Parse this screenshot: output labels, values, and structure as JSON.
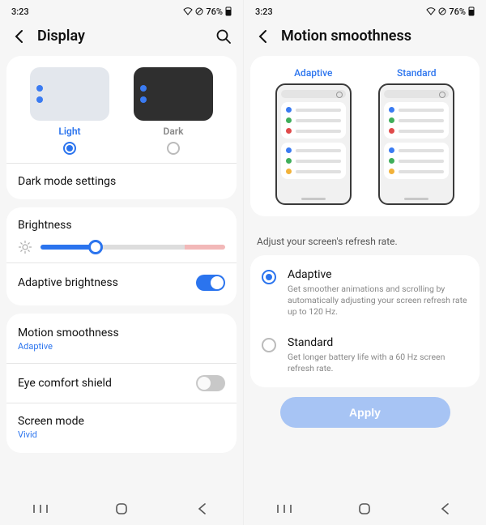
{
  "status": {
    "time": "3:23",
    "battery": "76%"
  },
  "left": {
    "title": "Display",
    "theme": {
      "light_label": "Light",
      "dark_label": "Dark",
      "selected": "light"
    },
    "dark_mode_settings": "Dark mode settings",
    "brightness": {
      "label": "Brightness",
      "value_pct": 30
    },
    "adaptive_brightness": {
      "label": "Adaptive brightness",
      "on": true
    },
    "motion_smoothness": {
      "label": "Motion smoothness",
      "value": "Adaptive"
    },
    "eye_comfort": {
      "label": "Eye comfort shield",
      "on": false
    },
    "screen_mode": {
      "label": "Screen mode",
      "value": "Vivid"
    }
  },
  "right": {
    "title": "Motion smoothness",
    "preview_labels": {
      "adaptive": "Adaptive",
      "standard": "Standard"
    },
    "description": "Adjust your screen's refresh rate.",
    "options": [
      {
        "title": "Adaptive",
        "sub": "Get smoother animations and scrolling by automatically adjusting your screen refresh rate up to 120 Hz.",
        "selected": true
      },
      {
        "title": "Standard",
        "sub": "Get longer battery life with a 60 Hz screen refresh rate.",
        "selected": false
      }
    ],
    "apply": "Apply"
  }
}
